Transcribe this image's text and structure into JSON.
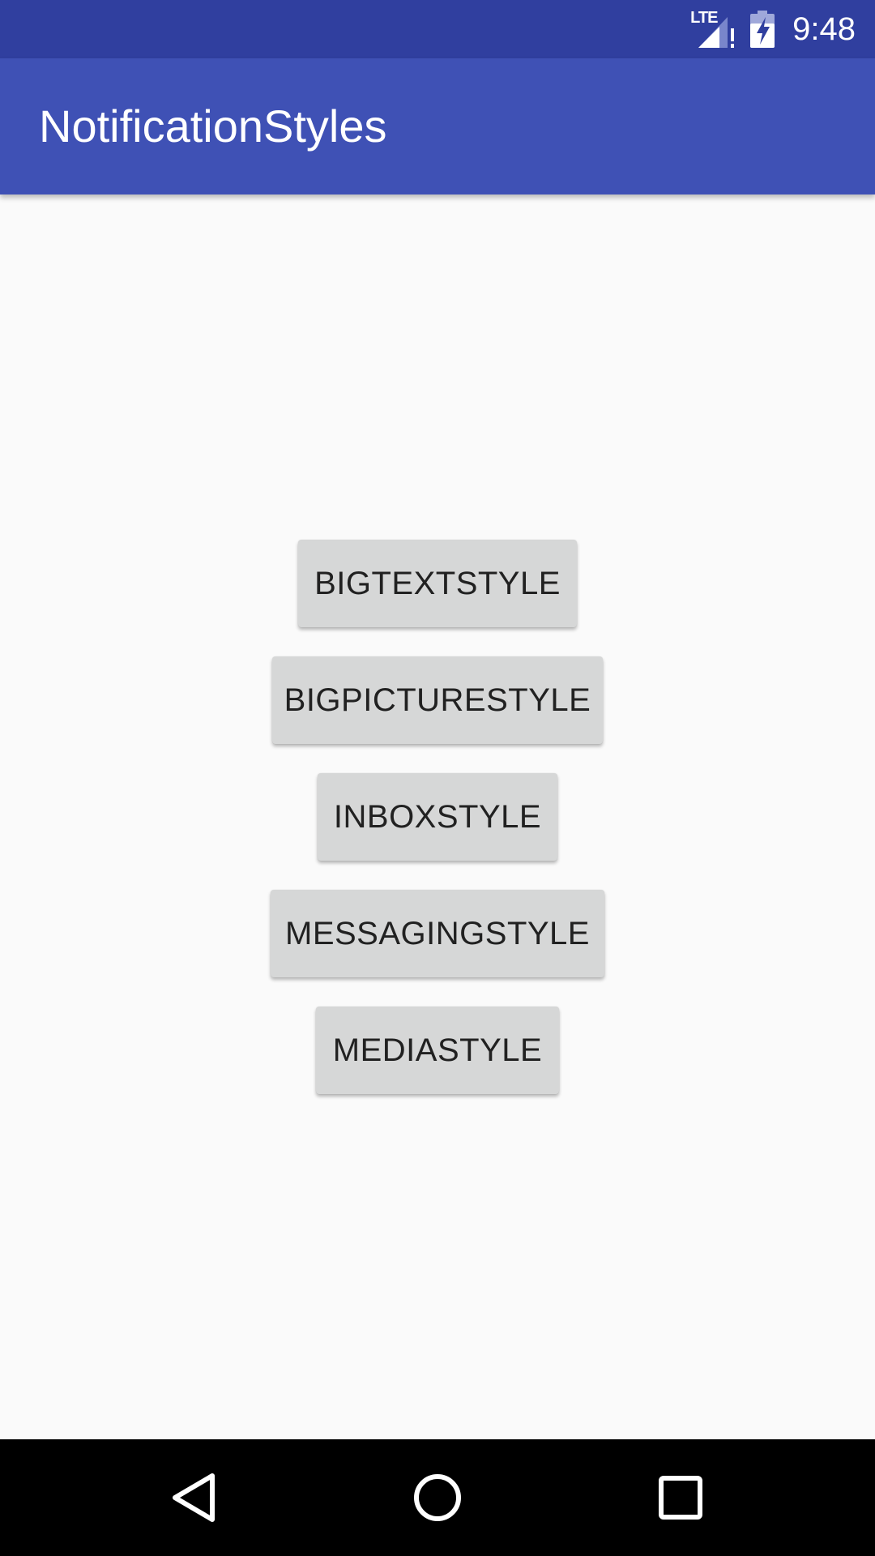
{
  "status_bar": {
    "network_label": "LTE",
    "time": "9:48",
    "icons": [
      "lte-signal-icon",
      "battery-charging-icon"
    ]
  },
  "app_bar": {
    "title": "NotificationStyles"
  },
  "buttons": [
    {
      "label": "BIGTEXTSTYLE"
    },
    {
      "label": "BIGPICTURESTYLE"
    },
    {
      "label": "INBOXSTYLE"
    },
    {
      "label": "MESSAGINGSTYLE"
    },
    {
      "label": "MEDIASTYLE"
    }
  ],
  "nav_bar": {
    "icons": [
      "back-icon",
      "home-icon",
      "recents-icon"
    ]
  },
  "colors": {
    "status_bar": "#303f9f",
    "primary": "#3f51b5",
    "background": "#fafafa",
    "button": "#d6d7d7",
    "button_text": "#212121",
    "nav_bar": "#000000"
  }
}
